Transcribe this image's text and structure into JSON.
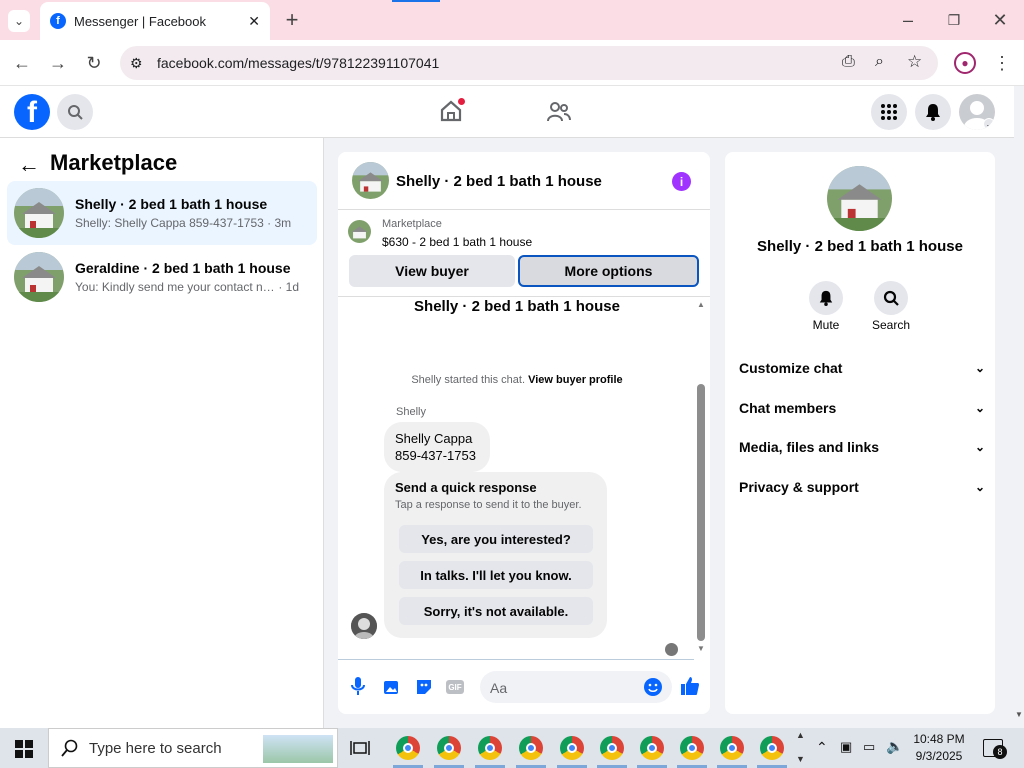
{
  "browser": {
    "tab_title": "Messenger | Facebook",
    "url": "facebook.com/messages/t/978122391107041"
  },
  "left": {
    "title": "Marketplace",
    "conversations": [
      {
        "title": "Shelly · 2 bed 1 bath 1 house",
        "preview": "Shelly: Shelly Cappa 859-437-1753",
        "time": "· 3m"
      },
      {
        "title": "Geraldine · 2 bed 1 bath 1 house",
        "preview": "You: Kindly send me your contact nu...",
        "time": "· 1d"
      }
    ]
  },
  "chat": {
    "header_title": "Shelly · 2 bed 1 bath 1 house",
    "listing_source": "Marketplace",
    "listing_desc": "$630 - 2 bed 1 bath 1 house",
    "view_buyer": "View buyer",
    "more_options": "More options",
    "thread_title": "Shelly · 2 bed 1 bath 1 house",
    "started_text": "Shelly started this chat.",
    "view_buyer_profile": "View buyer profile",
    "sender_name": "Shelly",
    "message_line1": "Shelly Cappa",
    "message_line2": "859-437-1753",
    "quick_title": "Send a quick response",
    "quick_sub": "Tap a response to send it to the buyer.",
    "quick_responses": [
      "Yes, are you interested?",
      "In talks. I'll let you know.",
      "Sorry, it's not available."
    ],
    "input_placeholder": "Aa"
  },
  "right": {
    "title": "Shelly · 2 bed 1 bath 1 house",
    "mute": "Mute",
    "search": "Search",
    "sections": [
      "Customize chat",
      "Chat members",
      "Media, files and links",
      "Privacy & support"
    ]
  },
  "taskbar": {
    "search_placeholder": "Type here to search",
    "time": "10:48 PM",
    "date": "9/3/2025",
    "notifications": "8"
  },
  "colors": {
    "fb_blue": "#0866ff",
    "accent_purple": "#a033ff",
    "active_row": "#ebf5ff"
  }
}
